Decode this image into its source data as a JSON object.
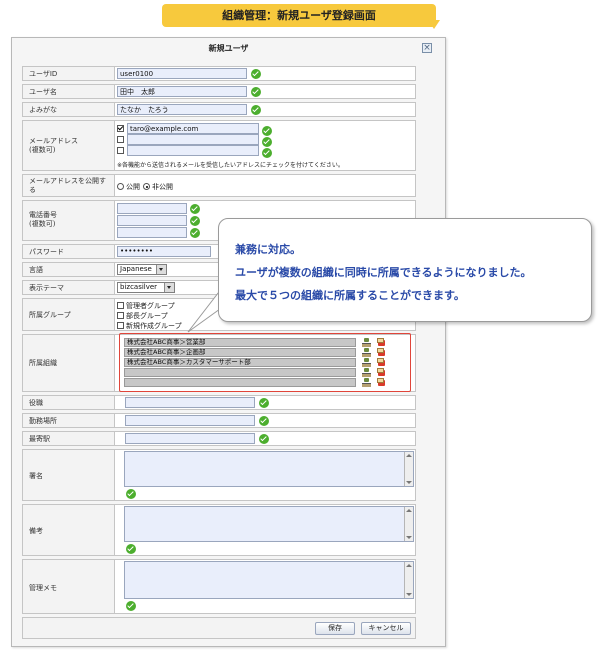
{
  "banner": {
    "title": "組織管理：新規ユーザ登録画面"
  },
  "dialog": {
    "title": "新規ユーザ",
    "close_symbol": "×"
  },
  "form": {
    "user_id": {
      "label": "ユーザID",
      "value": "user0100"
    },
    "user_name": {
      "label": "ユーザ名",
      "value": "田中　太郎"
    },
    "furigana": {
      "label": "よみがな",
      "value": "たなか　たろう"
    },
    "email": {
      "label": "メールアドレス\n(複数可)",
      "value1": "taro@example.com",
      "value2": "",
      "value3": "",
      "note": "※各機能から送信されるメールを受信したいアドレスにチェックを付けてください。"
    },
    "email_public": {
      "label": "メールアドレスを公開する",
      "option_public": "公開",
      "option_private": "非公開",
      "selected": "非公開"
    },
    "phone": {
      "label": "電話番号\n(複数可)"
    },
    "password": {
      "label": "パスワード",
      "value": "••••••••"
    },
    "language": {
      "label": "言語",
      "value": "Japanese"
    },
    "theme": {
      "label": "表示テーマ",
      "value": "bizcasilver"
    },
    "group": {
      "label": "所属グループ",
      "items": [
        "管理者グループ",
        "部長グループ",
        "新規作成グループ"
      ]
    },
    "organization": {
      "label": "所属組織",
      "items": [
        "株式会社ABC商事＞営業部",
        "株式会社ABC商事＞企画部",
        "株式会社ABC商事＞カスタマーサポート部",
        "",
        ""
      ]
    },
    "position": {
      "label": "役職"
    },
    "workplace": {
      "label": "勤務場所"
    },
    "nearest_station": {
      "label": "最寄駅"
    },
    "signature": {
      "label": "署名"
    },
    "remarks": {
      "label": "備考"
    },
    "admin_memo": {
      "label": "管理メモ"
    }
  },
  "buttons": {
    "save": "保存",
    "cancel": "キャンセル"
  },
  "callout": {
    "line1": "兼務に対応。",
    "line2": "ユーザが複数の組織に同時に所属できるようになりました。",
    "line3": "最大で５つの組織に所属することができます。"
  },
  "colors": {
    "banner": "#f7c93d",
    "callout_text": "#2a4aa8",
    "highlight": "#e0453a",
    "check": "#4cae2e"
  }
}
